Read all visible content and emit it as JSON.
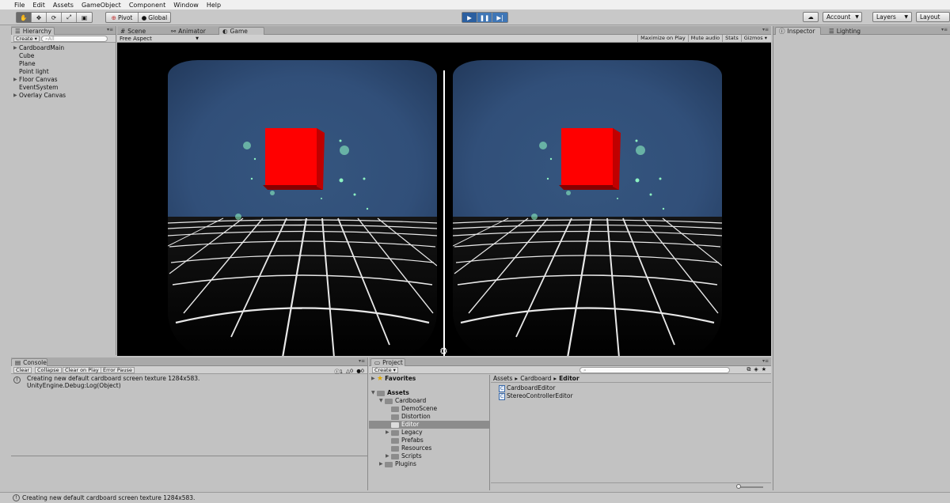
{
  "menu": [
    "File",
    "Edit",
    "Assets",
    "GameObject",
    "Component",
    "Window",
    "Help"
  ],
  "toolbar": {
    "pivot": "Pivot",
    "global": "Global",
    "account": "Account",
    "layers": "Layers",
    "layout": "Layout"
  },
  "hierarchy": {
    "tab": "Hierarchy",
    "create": "Create",
    "search_placeholder": "Αll",
    "items": [
      {
        "label": "CardboardMain",
        "expandable": true
      },
      {
        "label": "Cube",
        "expandable": false
      },
      {
        "label": "Plane",
        "expandable": false
      },
      {
        "label": "Point light",
        "expandable": false
      },
      {
        "label": "Floor Canvas",
        "expandable": true
      },
      {
        "label": "EventSystem",
        "expandable": false
      },
      {
        "label": "Overlay Canvas",
        "expandable": true
      }
    ]
  },
  "game": {
    "tabs": [
      "Scene",
      "Animator",
      "Game"
    ],
    "aspect": "Free Aspect",
    "options": [
      "Maximize on Play",
      "Mute audio",
      "Stats",
      "Gizmos"
    ]
  },
  "inspector": {
    "tabs": [
      "Inspector",
      "Lighting"
    ]
  },
  "console": {
    "tab": "Console",
    "buttons": [
      "Clear",
      "Collapse",
      "Clear on Play",
      "Error Pause"
    ],
    "counts": [
      "1",
      "0",
      "0"
    ],
    "message_line1": "Creating new default cardboard screen texture 1284x583.",
    "message_line2": "UnityEngine.Debug:Log(Object)"
  },
  "project": {
    "tab": "Project",
    "create": "Create",
    "favorites": "Favorites",
    "assets": "Assets",
    "tree": [
      {
        "label": "Cardboard",
        "depth": 1,
        "expanded": true
      },
      {
        "label": "DemoScene",
        "depth": 2
      },
      {
        "label": "Distortion",
        "depth": 2
      },
      {
        "label": "Editor",
        "depth": 2,
        "selected": true
      },
      {
        "label": "Legacy",
        "depth": 2,
        "expandable": true
      },
      {
        "label": "Prefabs",
        "depth": 2
      },
      {
        "label": "Resources",
        "depth": 2
      },
      {
        "label": "Scripts",
        "depth": 2,
        "expandable": true
      },
      {
        "label": "Plugins",
        "depth": 1,
        "expandable": true
      }
    ],
    "breadcrumb": [
      "Assets",
      "Cardboard",
      "Editor"
    ],
    "files": [
      "CardboardEditor",
      "StereoControllerEditor"
    ]
  },
  "status": "Creating new default cardboard screen texture 1284x583."
}
